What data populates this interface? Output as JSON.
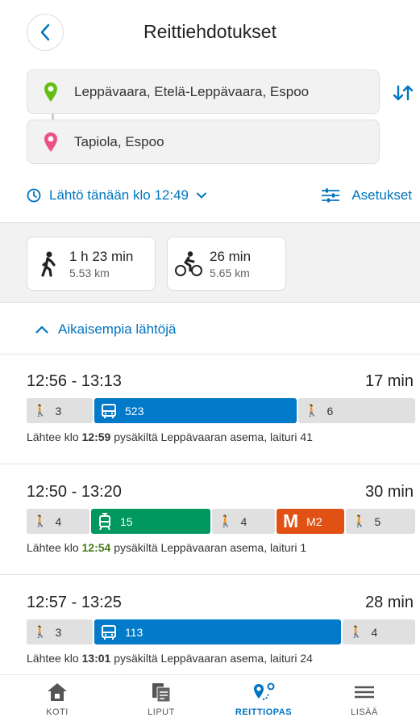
{
  "header": {
    "title": "Reittiehdotukset"
  },
  "locations": {
    "from": "Leppävaara, Etelä-Leppävaara, Espoo",
    "to": "Tapiola, Espoo"
  },
  "time_row": {
    "departure": "Lähtö tänään klo 12:49",
    "settings": "Asetukset"
  },
  "modes": {
    "walk": {
      "duration": "1 h 23 min",
      "distance": "5.53 km"
    },
    "bike": {
      "duration": "26 min",
      "distance": "5.65 km"
    }
  },
  "earlier_label": "Aikaisempia lähtöjä",
  "itineraries": [
    {
      "times": "12:56 - 13:13",
      "duration": "17 min",
      "legs": [
        {
          "type": "walk",
          "label": "3"
        },
        {
          "type": "bus",
          "label": "523"
        },
        {
          "type": "walk",
          "label": "6"
        }
      ],
      "depart_prefix": "Lähtee klo",
      "depart_time": "12:59",
      "depart_suffix": "pysäkiltä Leppävaaran asema, laituri 41"
    },
    {
      "times": "12:50 - 13:20",
      "duration": "30 min",
      "legs": [
        {
          "type": "walk",
          "label": "4"
        },
        {
          "type": "tram",
          "label": "15"
        },
        {
          "type": "walk",
          "label": "4"
        },
        {
          "type": "metro",
          "label": "M2",
          "badge": "M"
        },
        {
          "type": "walk",
          "label": "5"
        }
      ],
      "depart_prefix": "Lähtee klo",
      "depart_time": "12:54",
      "depart_suffix": "pysäkiltä Leppävaaran asema, laituri 1"
    },
    {
      "times": "12:57 - 13:25",
      "duration": "28 min",
      "legs": [
        {
          "type": "walk",
          "label": "3"
        },
        {
          "type": "bus",
          "label": "113"
        },
        {
          "type": "walk",
          "label": "4"
        }
      ],
      "depart_prefix": "Lähtee klo",
      "depart_time": "13:01",
      "depart_suffix": "pysäkiltä Leppävaaran asema, laituri 24"
    }
  ],
  "nav": {
    "home": "KOTI",
    "tickets": "LIPUT",
    "journey": "REITTIOPAS",
    "more": "LISÄÄ"
  },
  "colors": {
    "accent": "#0074bf",
    "bus": "#007ac9",
    "tram": "#00985f",
    "metro": "#e15113",
    "origin_pin": "#64be14",
    "destination_pin": "#ec5188"
  },
  "icons": {
    "back": "chevron-left-icon",
    "origin": "map-pin-green-icon",
    "destination": "map-pin-pink-icon",
    "swap": "swap-arrows-icon",
    "clock": "clock-icon",
    "settings": "sliders-icon",
    "walk": "walk-icon",
    "bike": "bike-icon",
    "earlier": "chevron-up-icon",
    "bus": "bus-icon",
    "tram": "tram-icon",
    "metro": "metro-icon",
    "home": "home-icon",
    "tickets": "ticket-icon",
    "journey": "route-icon",
    "more": "menu-icon"
  }
}
